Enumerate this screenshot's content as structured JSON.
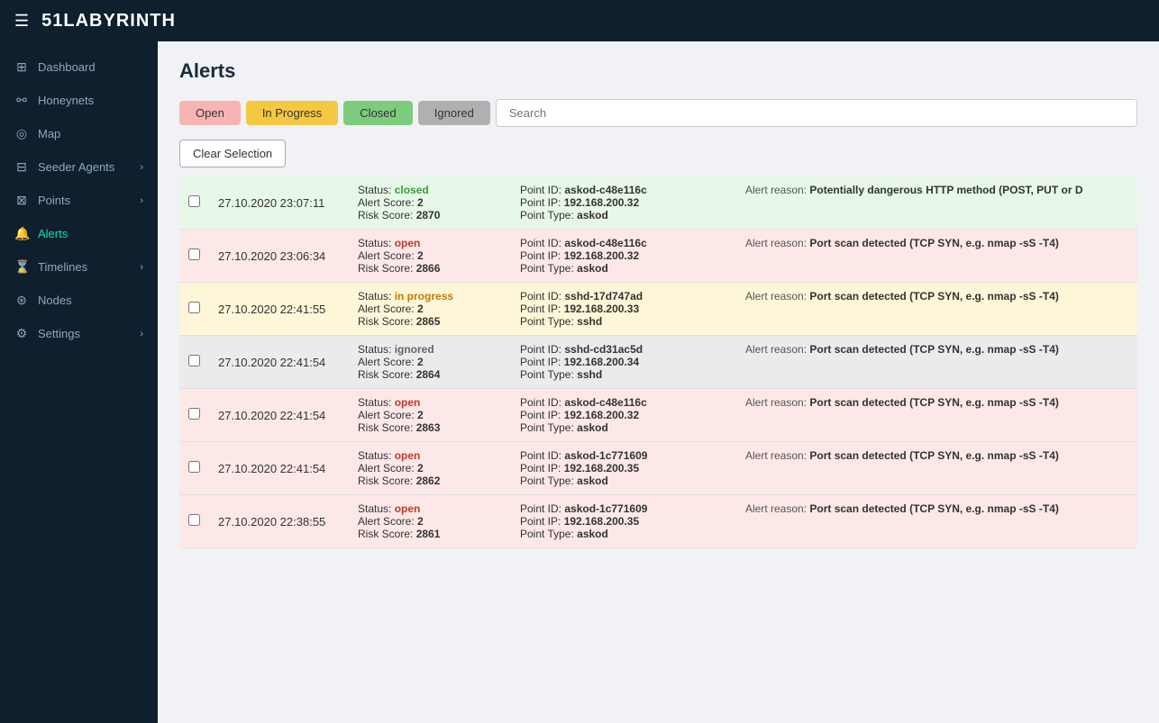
{
  "topbar": {
    "logo_text": "51LABYRINTH"
  },
  "sidebar": {
    "items": [
      {
        "id": "dashboard",
        "label": "Dashboard",
        "icon": "⊞",
        "active": false,
        "has_arrow": false
      },
      {
        "id": "honeynets",
        "label": "Honeynets",
        "icon": "⚯",
        "active": false,
        "has_arrow": false
      },
      {
        "id": "map",
        "label": "Map",
        "icon": "◎",
        "active": false,
        "has_arrow": false
      },
      {
        "id": "seeder-agents",
        "label": "Seeder Agents",
        "icon": "⊟",
        "active": false,
        "has_arrow": true
      },
      {
        "id": "points",
        "label": "Points",
        "icon": "⊠",
        "active": false,
        "has_arrow": true
      },
      {
        "id": "alerts",
        "label": "Alerts",
        "icon": "🔔",
        "active": true,
        "has_arrow": false
      },
      {
        "id": "timelines",
        "label": "Timelines",
        "icon": "⌛",
        "active": false,
        "has_arrow": true
      },
      {
        "id": "nodes",
        "label": "Nodes",
        "icon": "⊛",
        "active": false,
        "has_arrow": false
      },
      {
        "id": "settings",
        "label": "Settings",
        "icon": "⚙",
        "active": false,
        "has_arrow": true
      }
    ]
  },
  "page": {
    "title": "Alerts"
  },
  "filters": {
    "open_label": "Open",
    "in_progress_label": "In Progress",
    "closed_label": "Closed",
    "ignored_label": "Ignored",
    "search_placeholder": "Search"
  },
  "clear_selection_label": "Clear Selection",
  "alerts": [
    {
      "datetime": "27.10.2020 23:07:11",
      "status": "closed",
      "status_type": "closed",
      "alert_score": "2",
      "risk_score": "2870",
      "point_id": "askod-c48e116c",
      "point_ip": "192.168.200.32",
      "point_type": "askod",
      "alert_reason": "Potentially dangerous HTTP method (POST, PUT or D",
      "row_class": "row-closed"
    },
    {
      "datetime": "27.10.2020 23:06:34",
      "status": "open",
      "status_type": "open",
      "alert_score": "2",
      "risk_score": "2866",
      "point_id": "askod-c48e116c",
      "point_ip": "192.168.200.32",
      "point_type": "askod",
      "alert_reason": "Port scan detected (TCP SYN, e.g. nmap -sS -T4)",
      "row_class": "row-open"
    },
    {
      "datetime": "27.10.2020 22:41:55",
      "status": "in progress",
      "status_type": "in-progress",
      "alert_score": "2",
      "risk_score": "2865",
      "point_id": "sshd-17d747ad",
      "point_ip": "192.168.200.33",
      "point_type": "sshd",
      "alert_reason": "Port scan detected (TCP SYN, e.g. nmap -sS -T4)",
      "row_class": "row-in-progress"
    },
    {
      "datetime": "27.10.2020 22:41:54",
      "status": "ignored",
      "status_type": "ignored",
      "alert_score": "2",
      "risk_score": "2864",
      "point_id": "sshd-cd31ac5d",
      "point_ip": "192.168.200.34",
      "point_type": "sshd",
      "alert_reason": "Port scan detected (TCP SYN, e.g. nmap -sS -T4)",
      "row_class": "row-ignored"
    },
    {
      "datetime": "27.10.2020 22:41:54",
      "status": "open",
      "status_type": "open",
      "alert_score": "2",
      "risk_score": "2863",
      "point_id": "askod-c48e116c",
      "point_ip": "192.168.200.32",
      "point_type": "askod",
      "alert_reason": "Port scan detected (TCP SYN, e.g. nmap -sS -T4)",
      "row_class": "row-open"
    },
    {
      "datetime": "27.10.2020 22:41:54",
      "status": "open",
      "status_type": "open",
      "alert_score": "2",
      "risk_score": "2862",
      "point_id": "askod-1c771609",
      "point_ip": "192.168.200.35",
      "point_type": "askod",
      "alert_reason": "Port scan detected (TCP SYN, e.g. nmap -sS -T4)",
      "row_class": "row-open"
    },
    {
      "datetime": "27.10.2020 22:38:55",
      "status": "open",
      "status_type": "open",
      "alert_score": "2",
      "risk_score": "2861",
      "point_id": "askod-1c771609",
      "point_ip": "192.168.200.35",
      "point_type": "askod",
      "alert_reason": "Port scan detected (TCP SYN, e.g. nmap -sS -T4)",
      "row_class": "row-open"
    }
  ],
  "labels": {
    "status_prefix": "Status: ",
    "alert_score_prefix": "Alert Score: ",
    "risk_score_prefix": "Risk Score: ",
    "point_id_prefix": "Point ID: ",
    "point_ip_prefix": "Point IP: ",
    "point_type_prefix": "Point Type: ",
    "alert_reason_prefix": "Alert reason: "
  }
}
